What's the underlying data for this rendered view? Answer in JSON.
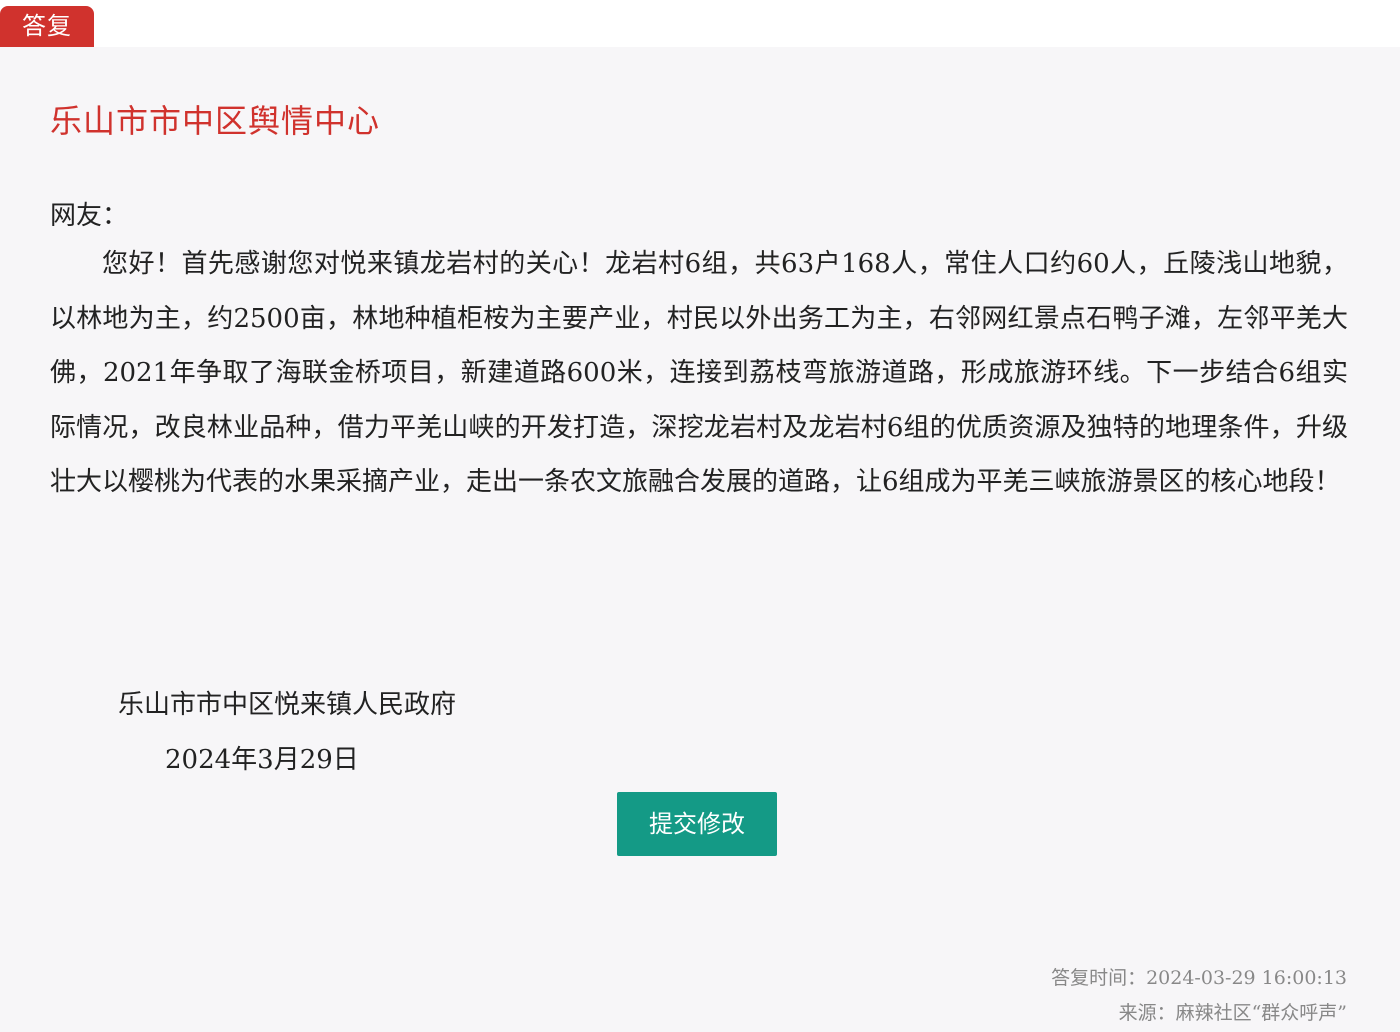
{
  "tab": {
    "label": "答复"
  },
  "reply": {
    "title": "乐山市市中区舆情中心",
    "greeting": "网友：",
    "body": "您好！首先感谢您对悦来镇龙岩村的关心！龙岩村6组，共63户168人，常住人口约60人，丘陵浅山地貌，以林地为主，约2500亩，林地种植柜桉为主要产业，村民以外出务工为主，右邻网红景点石鸭子滩，左邻平羌大佛，2021年争取了海联金桥项目，新建道路600米，连接到荔枝弯旅游道路，形成旅游环线。下一步结合6组实际情况，改良林业品种，借力平羌山峡的开发打造，深挖龙岩村及龙岩村6组的优质资源及独特的地理条件，升级壮大以樱桃为代表的水果采摘产业，走出一条农文旅融合发展的道路，让6组成为平羌三峡旅游景区的核心地段！",
    "signer": "乐山市市中区悦来镇人民政府",
    "date": "2024年3月29日"
  },
  "actions": {
    "submit_label": "提交修改"
  },
  "meta": {
    "reply_time": "答复时间：2024-03-29 16:00:13",
    "source": "来源：麻辣社区“群众呼声”"
  },
  "colors": {
    "accent_red": "#d0322d",
    "button_teal": "#149a86",
    "panel_bg": "#f7f6f8",
    "meta_gray": "#888888"
  }
}
